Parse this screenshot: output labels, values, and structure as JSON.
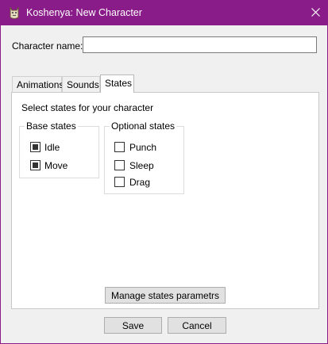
{
  "window": {
    "title": "Koshenya: New Character",
    "close_glyph": "✕",
    "accent_color": "#8a1c8a"
  },
  "form": {
    "character_name_label": "Character name:",
    "character_name_value": ""
  },
  "tabs": [
    {
      "label": "Animations",
      "active": false
    },
    {
      "label": "Sounds",
      "active": false
    },
    {
      "label": "States",
      "active": true
    }
  ],
  "states_panel": {
    "instructions": "Select states for your character",
    "base_states": {
      "legend": "Base states",
      "items": [
        {
          "label": "Idle",
          "checked": true
        },
        {
          "label": "Move",
          "checked": true
        }
      ]
    },
    "optional_states": {
      "legend": "Optional states",
      "items": [
        {
          "label": "Punch",
          "checked": false
        },
        {
          "label": "Sleep",
          "checked": false
        },
        {
          "label": "Drag",
          "checked": false
        }
      ]
    },
    "manage_button": "Manage states parametrs"
  },
  "footer": {
    "save_label": "Save",
    "cancel_label": "Cancel"
  },
  "icons": {
    "app": "cat-icon",
    "close": "close-icon"
  }
}
